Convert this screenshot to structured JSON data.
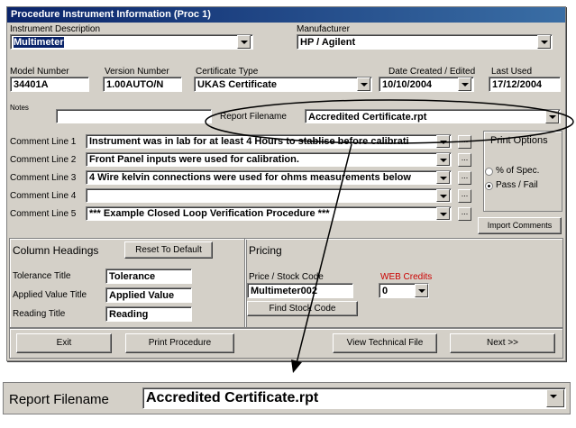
{
  "window": {
    "title": "Procedure Instrument Information (Proc 1)"
  },
  "instrument": {
    "desc_label": "Instrument Description",
    "desc_value": "Multimeter",
    "manufacturer_label": "Manufacturer",
    "manufacturer_value": "HP / Agilent",
    "model_label": "Model Number",
    "model_value": "34401A",
    "version_label": "Version Number",
    "version_value": "1.00AUTO/N",
    "cert_label": "Certificate Type",
    "cert_value": "UKAS Certificate",
    "date_label": "Date Created / Edited",
    "date_value": "10/10/2004",
    "lastused_label": "Last Used",
    "lastused_value": "17/12/2004"
  },
  "notes": {
    "label": "Notes",
    "value": ""
  },
  "report": {
    "label": "Report Filename",
    "value": "Accredited Certificate.rpt"
  },
  "comments": [
    {
      "label": "Comment Line 1",
      "value": "Instrument was in lab for at least 4 Hours to stablise before calibrati"
    },
    {
      "label": "Comment Line 2",
      "value": "Front Panel inputs were used for calibration."
    },
    {
      "label": "Comment Line 3",
      "value": "4 Wire kelvin connections were used for ohms measurements below"
    },
    {
      "label": "Comment Line 4",
      "value": ""
    },
    {
      "label": "Comment Line 5",
      "value": "*** Example Closed Loop Verification Procedure ***"
    }
  ],
  "ellipsis": "...",
  "print_options": {
    "label": "Print Options",
    "opt1": "% of Spec.",
    "opt2": "Pass / Fail",
    "selected": "Pass / Fail"
  },
  "import_button": "Import Comments",
  "column_headings": {
    "label": "Column Headings",
    "reset_button": "Reset To Default",
    "tol_label": "Tolerance Title",
    "tol_value": "Tolerance",
    "applied_label": "Applied Value Title",
    "applied_value": "Applied Value",
    "reading_label": "Reading Title",
    "reading_value": "Reading"
  },
  "pricing": {
    "label": "Pricing",
    "stock_label": "Price / Stock Code",
    "stock_value": "Multimeter002",
    "find_button": "Find Stock Code",
    "credits_label": "WEB Credits",
    "credits_value": "0",
    "credits_color": "#cc0000"
  },
  "buttons": {
    "exit": "Exit",
    "print": "Print Procedure",
    "view": "View Technical File",
    "next": "Next >>"
  },
  "zoom": {
    "label": "Report Filename",
    "value": "Accredited Certificate.rpt"
  }
}
